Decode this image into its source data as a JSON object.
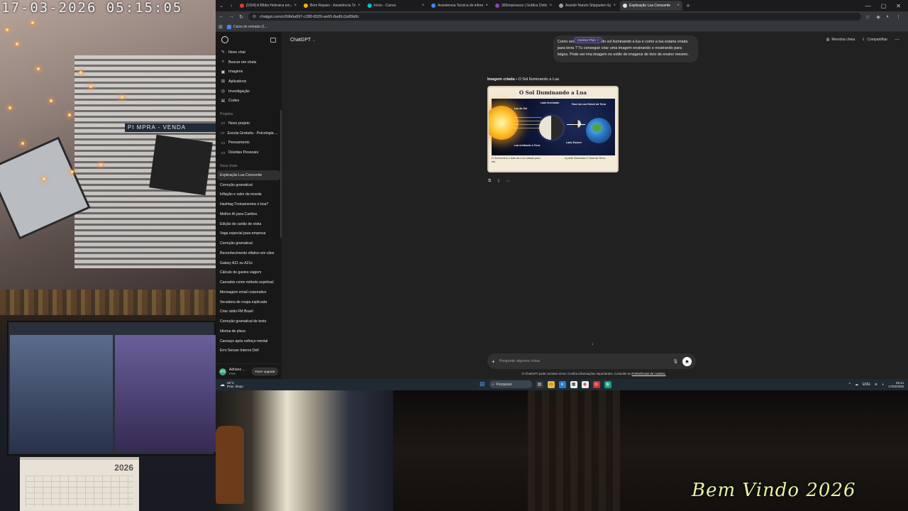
{
  "overlay": {
    "camera_timestamp": "17-03-2026  05:15:05",
    "window_sign": "PI    MPRA - VENDA",
    "calendar_year": "2026",
    "welcome_text": "Bem Vindo 2026"
  },
  "browser": {
    "tabs": [
      {
        "label": "[1004] A Bíblia Hebraica em Ár...",
        "color": "#e53935"
      },
      {
        "label": "Bom Reparo - Assistência Técnic...",
        "color": "#f4b400"
      },
      {
        "label": "Início - Canva",
        "color": "#00c4cc"
      },
      {
        "label": "Assistencia Tecnica de informati...",
        "color": "#4285f4"
      },
      {
        "label": "300impressos | Gráfica Online, H...",
        "color": "#8e44ad"
      },
      {
        "label": "Assistir Naruto Shippuden Epis...",
        "color": "#9e9e9e"
      },
      {
        "label": "Explicação Lua Crescente",
        "color": "#e0e0e0",
        "active": true
      }
    ],
    "url": "chatgpt.com/c/69b6a697-c280-8329-ae65-8ad0c2a95b8c",
    "bookmark": "Caixa de entrada (1..."
  },
  "sidebar": {
    "items": [
      {
        "label": "Novo chat",
        "icon": "new-chat-icon",
        "glyph": "✎"
      },
      {
        "label": "Buscar em chats",
        "icon": "search-icon",
        "glyph": "⌕"
      },
      {
        "label": "Imagens",
        "icon": "images-icon",
        "glyph": "▣"
      },
      {
        "label": "Aplicativos",
        "icon": "apps-icon",
        "glyph": "⊞"
      },
      {
        "label": "Investigação",
        "icon": "research-icon",
        "glyph": "◎"
      },
      {
        "label": "Codex",
        "icon": "codex-icon",
        "glyph": "⌘"
      }
    ],
    "projects_header": "Projetos",
    "projects": [
      {
        "label": "Novo projeto",
        "icon": "folder-plus-icon",
        "glyph": "▭"
      },
      {
        "label": "Escola Gratuita - Psicologia ...",
        "icon": "folder-icon",
        "glyph": "▭"
      },
      {
        "label": "Pensamento",
        "icon": "folder-icon",
        "glyph": "▭"
      },
      {
        "label": "Dúvidas Pessoais",
        "icon": "folder-icon",
        "glyph": "▭"
      }
    ],
    "chats_header": "Seus chats",
    "chats": [
      "Explicação Lua Crescente",
      "Correção gramatical",
      "Inflação e valor da moeda",
      "Hashtag Treinamentos é boa?",
      "Melhor AI para Cartões",
      "Edição de cartão de visita",
      "Vaga especial para empresa",
      "Correção gramatical",
      "Reconhecimento olfativo em cães",
      "Galaxy A21 ou A21s",
      "Cálculo de gastos viagem",
      "Cannabis como método espiritual",
      "Mensagem email corporativo",
      "Secadora de roupa explicada",
      "Criar rádio FM Brasil",
      "Correção gramatical de texto",
      "Idioma de placa",
      "Cansaço após esforço mental",
      "Erro Sensor Interno Dell"
    ],
    "user": {
      "name": "Adriano ...",
      "plan": "Free",
      "avatar_initial": "AS",
      "upgrade_label": "Fazer upgrade"
    }
  },
  "main": {
    "model_label": "ChatGPT",
    "memory_label": "Memória cheia",
    "share_label": "Compartilhar",
    "plus_pill": "Assinar Plus",
    "user_message": "Como seria          desse retrato do sol iluminando a lua e como a lua estaria virada para terra ? Tu conseguir criar uma imagem ensinando e mostrando para leigos. Pode ser ima imagem no estilo de imagens de livro de ensino mesmo.",
    "image_label_bold": "Imagem criada",
    "image_label_rest": " • O Sol Iluminando a Lua",
    "image": {
      "title": "O Sol Iluminando a Lua",
      "lbl_sunlight": "Luz do Sol",
      "lbl_lit_side": "Lado Iluminado",
      "lbl_visible_face": "Face da Lua Visível da Terra",
      "lbl_dark_side": "Lado Escuro",
      "lbl_orbit": "Lua orbitando a Terra",
      "note_left": "O Sol ilumina o lado da Lua voltado para ele.",
      "note_right": "A parte iluminada é Vista da Terra."
    },
    "composer_placeholder": "Pergunte alguma coisa",
    "disclaimer": "O ChatGPT pode cometer erros. Confira informações importantes. Consulte as",
    "disclaimer_link": "Preferências de cookies."
  },
  "taskbar": {
    "temp": "25°C",
    "weather_desc": "Prox. limpo",
    "search_label": "Pesquisar",
    "lang": "ENG",
    "time": "05:14",
    "date": "17/03/2026"
  }
}
